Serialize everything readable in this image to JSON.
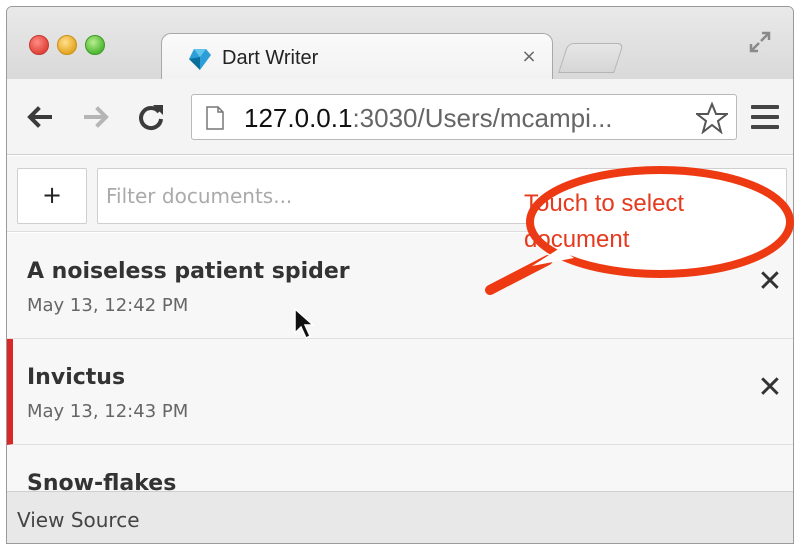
{
  "browser": {
    "tab_title": "Dart Writer",
    "tab_close_glyph": "×",
    "url_host": "127.0.0.1",
    "url_rest": ":3030/Users/mcampi...",
    "icons": [
      "dart-logo-icon",
      "close-icon",
      "fullscreen-icon",
      "back-arrow-icon",
      "forward-arrow-icon",
      "reload-icon",
      "page-icon",
      "star-icon",
      "menu-icon"
    ]
  },
  "app": {
    "add_label": "+",
    "filter_placeholder": "Filter documents...",
    "documents": [
      {
        "title": "A noiseless patient spider",
        "date": "May 13, 12:42 PM",
        "selected": false
      },
      {
        "title": "Invictus",
        "date": "May 13, 12:43 PM",
        "selected": true
      },
      {
        "title": "Snow-flakes",
        "date": "",
        "selected": false
      }
    ],
    "delete_glyph": "✕",
    "selected_accent": "#d92828"
  },
  "footer": {
    "view_source_label": "View Source"
  },
  "annotation": {
    "line1": "Touch to select",
    "line2": "document",
    "color": "#e53a1e"
  }
}
